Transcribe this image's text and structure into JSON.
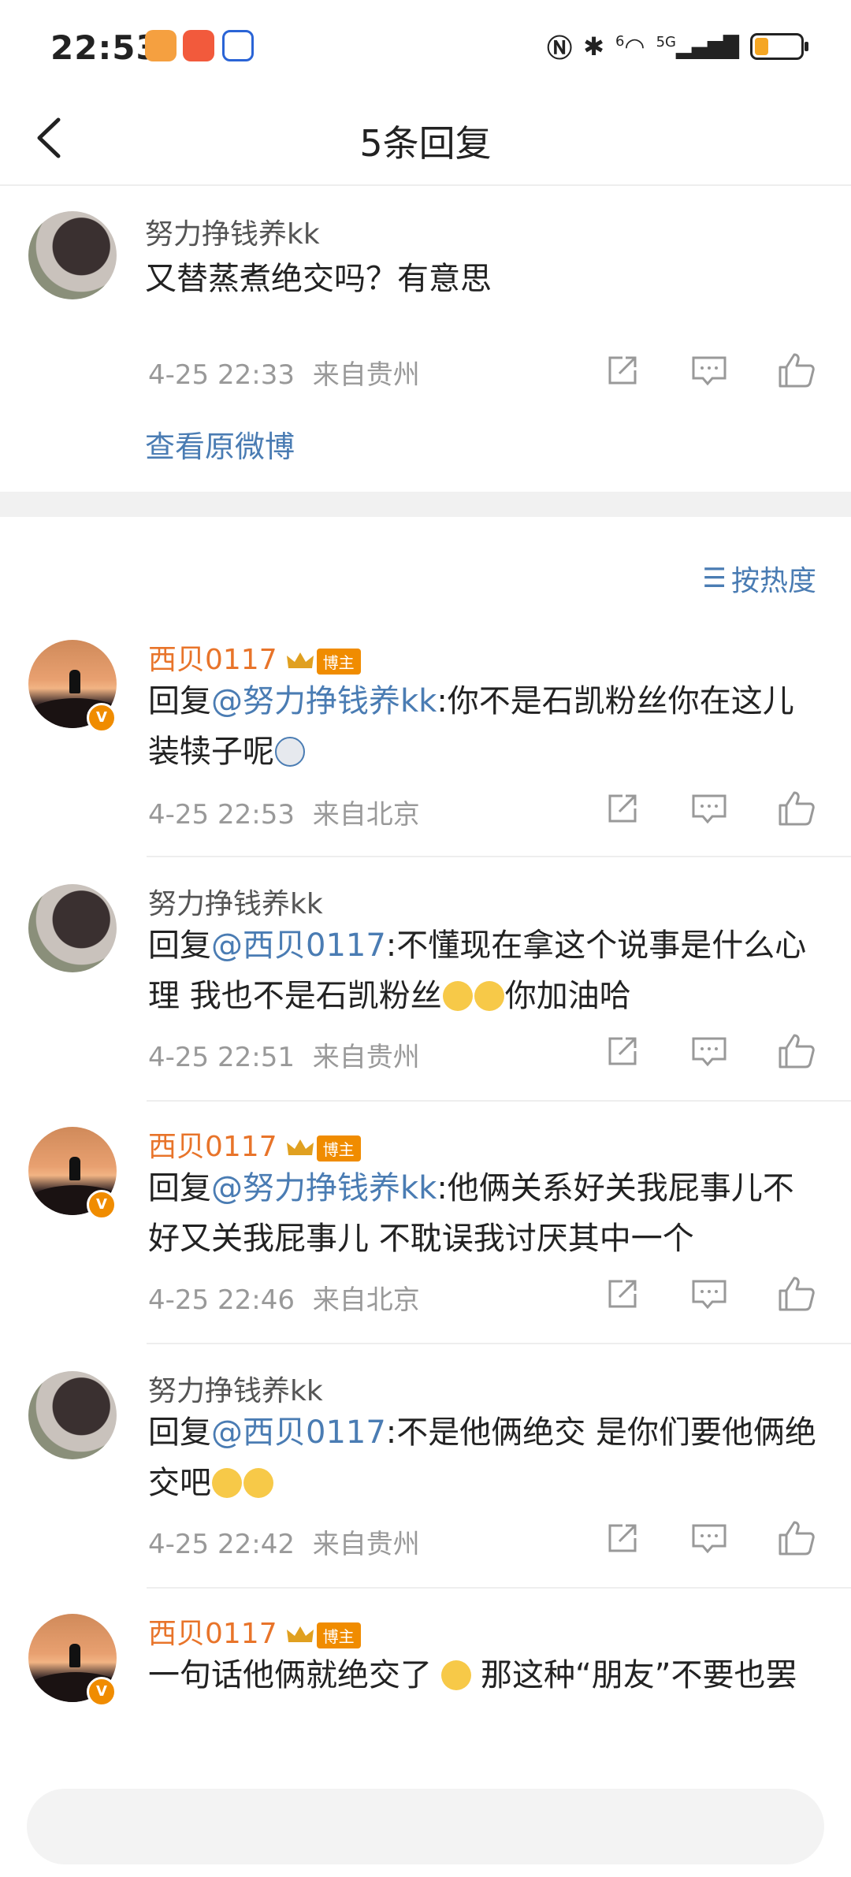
{
  "status_bar": {
    "time": "22:53",
    "network_label": "5G",
    "wifi_label": "6",
    "battery_level": 0.3,
    "battery_color": "#f5a623"
  },
  "header": {
    "title": "5条回复",
    "back_icon": "chevron-left-icon"
  },
  "original_comment": {
    "username": "努力挣钱养kk",
    "text": "又替蒸煮绝交吗？有意思",
    "time": "4-25 22:33",
    "location": "来自贵州",
    "view_original_label": "查看原微博"
  },
  "sort": {
    "label": "按热度",
    "icon": "sort-icon"
  },
  "blogger_tag": "博主",
  "replies": [
    {
      "username": "西贝0117",
      "is_blogger": true,
      "reply_prefix": "回复",
      "mention": "@努力挣钱养kk",
      "text": ":你不是石凯粉丝你在这儿装犊子呢",
      "emoji": "doge",
      "time": "4-25 22:53",
      "location": "来自北京"
    },
    {
      "username": "努力挣钱养kk",
      "is_blogger": false,
      "reply_prefix": "回复",
      "mention": "@西贝0117",
      "text": ":不懂现在拿这个说事是什么心理 我也不是石凯粉丝",
      "text_tail": "你加油哈",
      "time": "4-25 22:51",
      "location": "来自贵州"
    },
    {
      "username": "西贝0117",
      "is_blogger": true,
      "reply_prefix": "回复",
      "mention": "@努力挣钱养kk",
      "text": ":他俩关系好关我屁事儿不好又关我屁事儿 不耽误我讨厌其中一个",
      "time": "4-25 22:46",
      "location": "来自北京"
    },
    {
      "username": "努力挣钱养kk",
      "is_blogger": false,
      "reply_prefix": "回复",
      "mention": "@西贝0117",
      "text": ":不是他俩绝交 是你们要他俩绝交吧",
      "time": "4-25 22:42",
      "location": "来自贵州"
    },
    {
      "username": "西贝0117",
      "is_blogger": true,
      "text_a": "一句话他俩就绝交了",
      "text_b": "那这种“朋友”不要也罢"
    }
  ],
  "colors": {
    "link": "#4a7cb3",
    "blogger_name": "#e8742a",
    "meta": "#999999",
    "badge": "#f08c00"
  }
}
